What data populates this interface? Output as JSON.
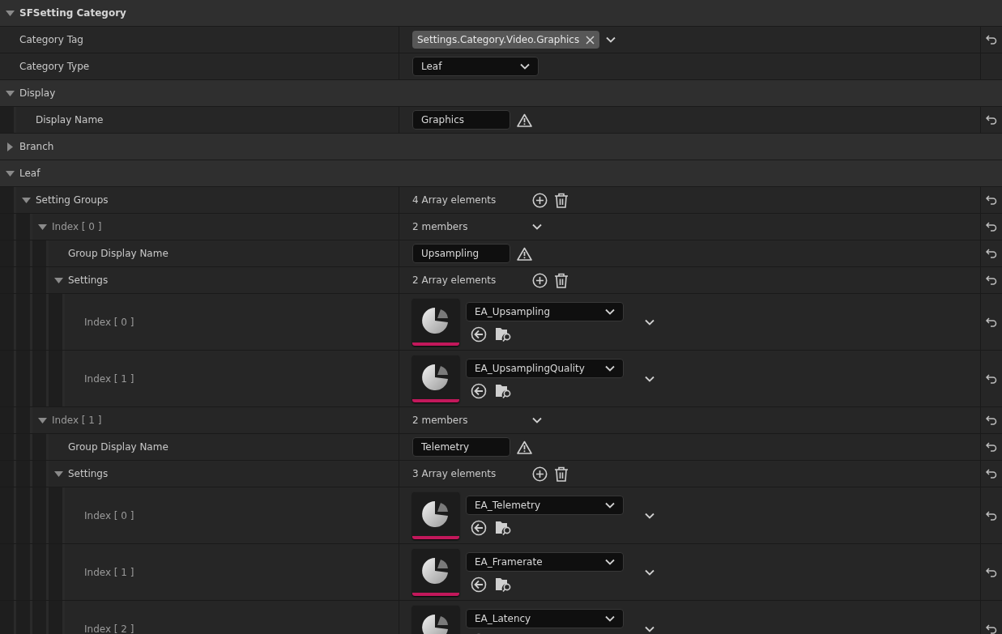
{
  "sections": [
    {
      "label": "SFSetting Category",
      "kind": "root",
      "expanded": true,
      "children": [
        {
          "label": "Category Tag",
          "kind": "tag",
          "value": "Settings.Category.Video.Graphics",
          "reset": true
        },
        {
          "label": "Category Type",
          "kind": "combo",
          "value": "Leaf",
          "reset": false
        }
      ]
    },
    {
      "label": "Display",
      "kind": "category",
      "expanded": true,
      "children": [
        {
          "label": "Display Name",
          "kind": "text",
          "value": "Graphics",
          "warning": true,
          "reset": true
        }
      ]
    },
    {
      "label": "Branch",
      "kind": "category",
      "expanded": false
    },
    {
      "label": "Leaf",
      "kind": "category",
      "expanded": true,
      "children": [
        {
          "label": "Setting Groups",
          "kind": "array",
          "value": "4 Array elements",
          "expanded": true,
          "reset": true,
          "children": [
            {
              "label": "Index [ 0 ]",
              "kind": "struct",
              "value": "2 members",
              "expanded": true,
              "reset": true,
              "children": [
                {
                  "label": "Group Display Name",
                  "kind": "text",
                  "value": "Upsampling",
                  "warning": true,
                  "reset": true
                },
                {
                  "label": "Settings",
                  "kind": "array",
                  "value": "2 Array elements",
                  "expanded": true,
                  "reset": true,
                  "children": [
                    {
                      "label": "Index [ 0 ]",
                      "kind": "asset",
                      "value": "EA_Upsampling",
                      "reset": true
                    },
                    {
                      "label": "Index [ 1 ]",
                      "kind": "asset",
                      "value": "EA_UpsamplingQuality",
                      "reset": true
                    }
                  ]
                }
              ]
            },
            {
              "label": "Index [ 1 ]",
              "kind": "struct",
              "value": "2 members",
              "expanded": true,
              "reset": true,
              "children": [
                {
                  "label": "Group Display Name",
                  "kind": "text",
                  "value": "Telemetry",
                  "warning": true,
                  "reset": true
                },
                {
                  "label": "Settings",
                  "kind": "array",
                  "value": "3 Array elements",
                  "expanded": true,
                  "reset": true,
                  "children": [
                    {
                      "label": "Index [ 0 ]",
                      "kind": "asset",
                      "value": "EA_Telemetry",
                      "reset": true
                    },
                    {
                      "label": "Index [ 1 ]",
                      "kind": "asset",
                      "value": "EA_Framerate",
                      "reset": true
                    },
                    {
                      "label": "Index [ 2 ]",
                      "kind": "asset",
                      "value": "EA_Latency",
                      "reset": true
                    }
                  ]
                }
              ]
            }
          ]
        }
      ]
    }
  ]
}
